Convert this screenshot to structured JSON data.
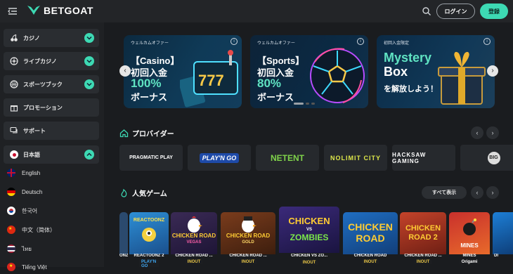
{
  "header": {
    "brand": "BETGOAT",
    "login_label": "ログイン",
    "register_label": "登録"
  },
  "sidebar": {
    "items": [
      {
        "label": "カジノ",
        "icon": "cherries-icon",
        "expandable": true
      },
      {
        "label": "ライブカジノ",
        "icon": "roulette-icon",
        "expandable": true
      },
      {
        "label": "スポーツブック",
        "icon": "basketball-icon",
        "expandable": true
      },
      {
        "label": "プロモーション",
        "icon": "gift-icon",
        "expandable": false
      },
      {
        "label": "サポート",
        "icon": "chat-icon",
        "expandable": false
      }
    ],
    "language": {
      "label": "日本語",
      "icon": "japan-flag-icon"
    },
    "languages": [
      {
        "label": "English",
        "icon": "uk-flag-icon"
      },
      {
        "label": "Deutsch",
        "icon": "germany-flag-icon"
      },
      {
        "label": "한국어",
        "icon": "korea-flag-icon"
      },
      {
        "label": "中文（简体）",
        "icon": "china-flag-icon"
      },
      {
        "label": "ไทย",
        "icon": "thailand-flag-icon"
      },
      {
        "label": "Tiếng Việt",
        "icon": "vietnam-flag-icon"
      }
    ]
  },
  "banners": [
    {
      "tag": "ウェルカムオファー",
      "line1": "【Casino】",
      "line2": "初回入金",
      "line3": "100%",
      "line4": "ボーナス"
    },
    {
      "tag": "ウェルカムオファー",
      "line1": "【Sports】",
      "line2": "初回入金",
      "line3": "80%",
      "line4": "ボーナス"
    },
    {
      "tag": "初回入金限定",
      "line1": "Mystery",
      "line2": "Box",
      "line3": "を解放しよう！"
    }
  ],
  "providers": {
    "title": "プロバイダー",
    "items": [
      "PRAGMATIC PLAY",
      "PLAY'N GO",
      "NETENT",
      "NOLIMIT CITY",
      "HACKSAW GAMING",
      "BIG"
    ]
  },
  "popular": {
    "title": "人気ゲーム",
    "view_all": "すべて表示",
    "games": [
      {
        "name": "ONZ",
        "thumb": "",
        "badge": ""
      },
      {
        "name": "REACTOONZ 2",
        "thumb": "REACTOONZ",
        "badge": "PLAY'N GO"
      },
      {
        "name": "CHICKEN ROAD ...",
        "thumb": "CHICKEN ROAD",
        "thumb2": "VEGAS",
        "badge": "INOUT"
      },
      {
        "name": "CHICKEN ROAD ...",
        "thumb": "CHICKEN ROAD",
        "thumb2": "GOLD",
        "badge": "INOUT"
      },
      {
        "name": "CHICKEN VS ZO...",
        "thumb": "CHICKEN",
        "thumb2": "ZOMBIES",
        "badge": "INOUT"
      },
      {
        "name": "CHICKEN ROAD",
        "thumb": "CHICKEN",
        "thumb2": "ROAD",
        "badge": "INOUT"
      },
      {
        "name": "CHICKEN ROAD ...",
        "thumb": "CHICKEN",
        "thumb2": "ROAD 2",
        "badge": "INOUT"
      },
      {
        "name": "MINES",
        "thumb": "MINES",
        "badge": "Origami"
      },
      {
        "name": "DI",
        "thumb": "",
        "badge": ""
      }
    ]
  },
  "colors": {
    "accent": "#3dd9b3",
    "background": "#1a1c1f",
    "sidebar": "#1f2124",
    "card": "#2a2d31"
  }
}
